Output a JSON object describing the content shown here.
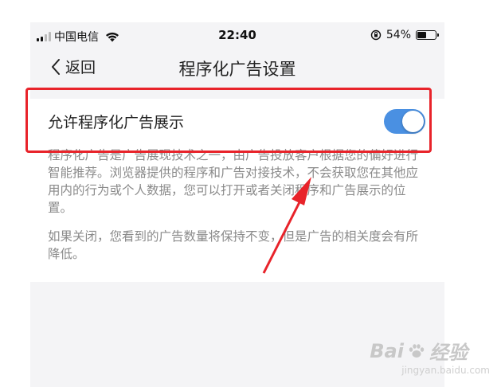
{
  "status_bar": {
    "carrier": "中国电信",
    "time": "22:40",
    "battery_percent": "54%",
    "battery_level": 0.54
  },
  "nav": {
    "back_label": "返回",
    "title": "程序化广告设置"
  },
  "setting": {
    "label": "允许程序化广告展示",
    "enabled": true
  },
  "description": {
    "paragraph1": "程序化广告是广告展现技术之一，由广告投放客户根据您的偏好进行智能推荐。浏览器提供的程序和广告对接技术，不会获取您在其他应用内的行为或个人数据，您可以打开或者关闭程序和广告展示的位置。",
    "paragraph2": "如果关闭，您看到的广告数量将保持不变，但是广告的相关度会有所降低。"
  },
  "watermark": {
    "brand": "Bai",
    "brand_cn": "经验",
    "url": "jingyan.baidu.com"
  },
  "colors": {
    "toggle_on": "#4a90e2",
    "highlight": "#e8232a",
    "background": "#f4f4f6",
    "description_text": "#8a8a8a"
  }
}
